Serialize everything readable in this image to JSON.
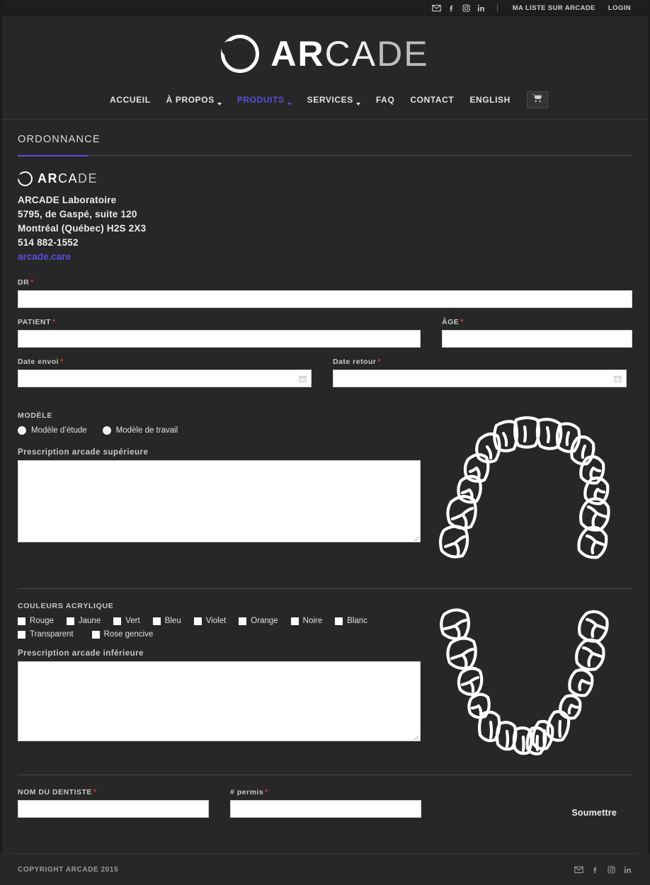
{
  "topbar": {
    "icons": [
      "email-icon",
      "facebook-icon",
      "instagram-icon",
      "linkedin-icon"
    ],
    "my_list_label": "MA LISTE SUR ARCADE",
    "login_label": "LOGIN"
  },
  "brand": {
    "word1": "AR",
    "word2": "CA",
    "word3": "DE"
  },
  "nav": {
    "items": [
      {
        "label": "ACCUEIL",
        "caret": false,
        "active": false
      },
      {
        "label": "À PROPOS",
        "caret": true,
        "active": false
      },
      {
        "label": "PRODUITS",
        "caret": true,
        "active": true
      },
      {
        "label": "SERVICES",
        "caret": true,
        "active": false
      },
      {
        "label": "FAQ",
        "caret": false,
        "active": false
      },
      {
        "label": "CONTACT",
        "caret": false,
        "active": false
      },
      {
        "label": "ENGLISH",
        "caret": false,
        "active": false
      }
    ],
    "cart_label": "cart-icon"
  },
  "page": {
    "title": "ORDONNANCE",
    "accent_color": "#5b4ddb"
  },
  "company": {
    "name": "ARCADE Laboratoire",
    "street": "5795, de Gaspé, suite 120",
    "city": "Montréal (Québec) H2S 2X3",
    "phone": "514 882-1552",
    "website": "arcade.care"
  },
  "form": {
    "dr": {
      "label": "DR",
      "required": "*",
      "value": "",
      "placeholder": ""
    },
    "patient": {
      "label": "PATIENT",
      "required": "*",
      "value": "",
      "placeholder": ""
    },
    "age": {
      "label": "ÂGE",
      "required": "*",
      "value": "",
      "placeholder": ""
    },
    "date_envoi": {
      "label": "Date envoi",
      "required": "*",
      "value": "",
      "placeholder": ""
    },
    "date_retour": {
      "label": "Date retour",
      "required": "*",
      "value": "",
      "placeholder": ""
    },
    "modele": {
      "label": "MODÈLE",
      "options": [
        {
          "label": "Modèle d’étude"
        },
        {
          "label": "Modèle de travail"
        }
      ]
    },
    "prescription_sup": {
      "label": "Prescription arcade supérieure",
      "value": "",
      "placeholder": ""
    },
    "couleurs": {
      "label": "COULEURS ACRYLIQUE",
      "options": [
        {
          "label": "Rouge"
        },
        {
          "label": "Jaune"
        },
        {
          "label": "Vert"
        },
        {
          "label": "Bleu"
        },
        {
          "label": "Violet"
        },
        {
          "label": "Orange"
        },
        {
          "label": "Noire"
        },
        {
          "label": "Blanc"
        },
        {
          "label": "Transparent"
        },
        {
          "label": "Rose gencive"
        }
      ]
    },
    "prescription_inf": {
      "label": "Prescription arcade inférieure",
      "value": "",
      "placeholder": ""
    },
    "nom_dentiste": {
      "label": "NOM DU DENTISTE",
      "required": "*",
      "value": "",
      "placeholder": ""
    },
    "permis": {
      "label": "# permis",
      "required": "*",
      "value": "",
      "placeholder": ""
    },
    "submit_label": "Soumettre"
  },
  "diagrams": {
    "upper_arch": "upper-dental-arch-diagram",
    "lower_arch": "lower-dental-arch-diagram"
  },
  "footer": {
    "copyright": "COPYRIGHT ARCADE 2015",
    "icons": [
      "email-icon",
      "facebook-icon",
      "instagram-icon",
      "linkedin-icon"
    ]
  }
}
